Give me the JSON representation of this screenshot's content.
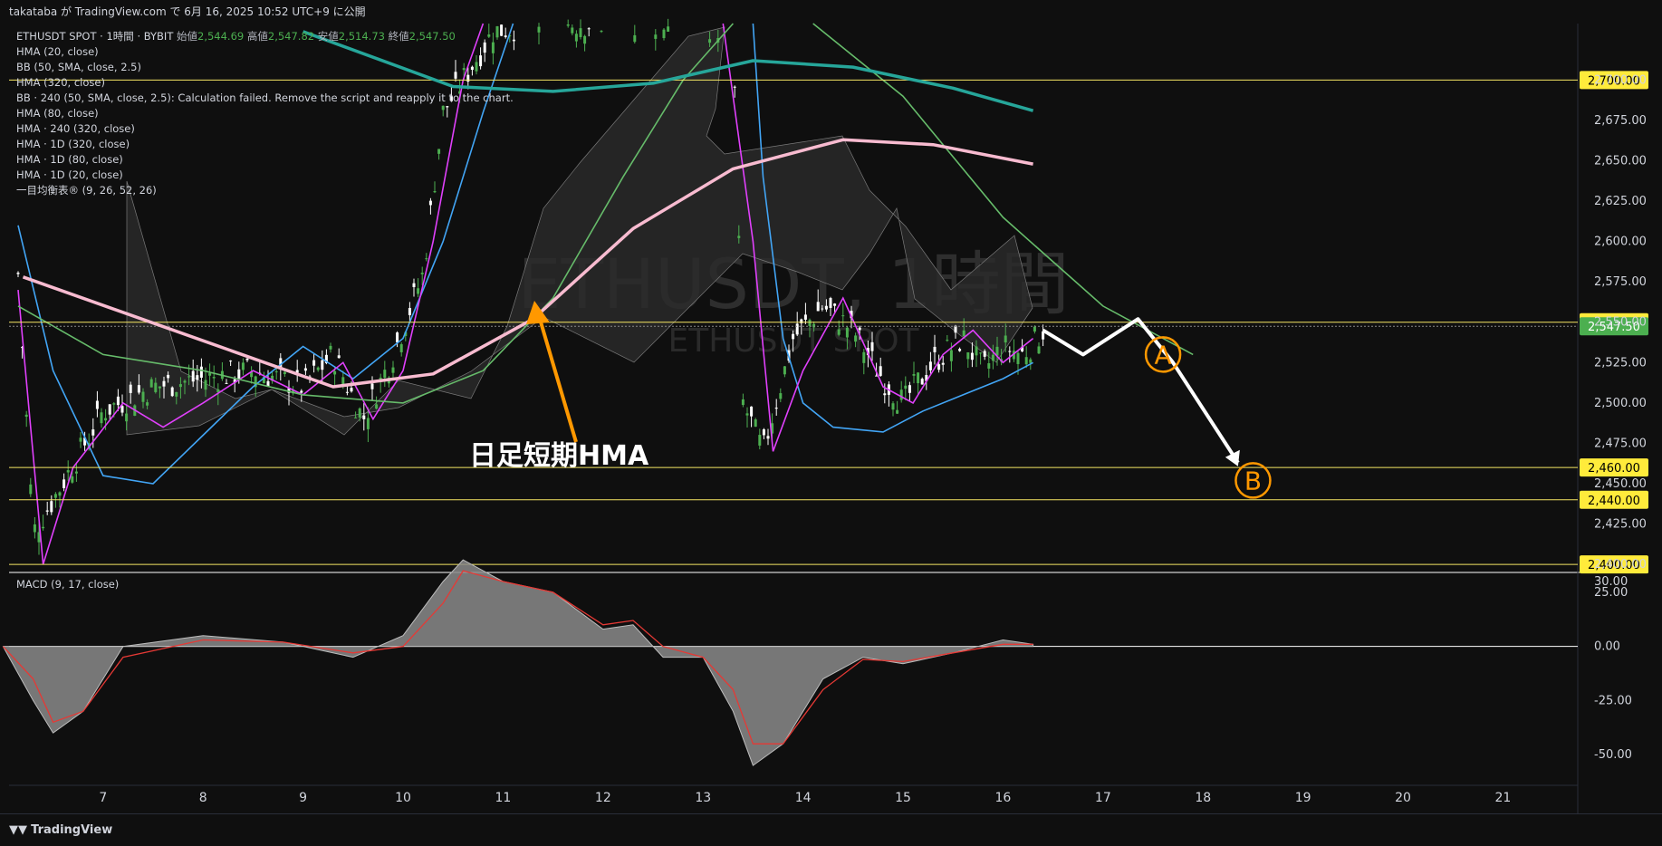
{
  "header": {
    "publish_line": "takataba が TradingView.com で 6月 16, 2025 10:52 UTC+9 に公開"
  },
  "legend": {
    "symbol": "ETHUSDT SPOT · 1時間 · BYBIT",
    "open_label": "始値",
    "open": "2,544.69",
    "high_label": "高値",
    "high": "2,547.82",
    "low_label": "安値",
    "low": "2,514.73",
    "close_label": "終値",
    "close": "2,547.50",
    "indicators": [
      "HMA (20, close)",
      "BB (50, SMA, close, 2.5)",
      "HMA (320, close)",
      "BB · 240 (50, SMA, close, 2.5): Calculation failed. Remove the script and reapply it to the chart.",
      "HMA (80, close)",
      "HMA · 240 (320, close)",
      "HMA · 1D (320, close)",
      "HMA · 1D (80, close)",
      "HMA · 1D (20, close)",
      "一目均衡表® (9, 26, 52, 26)"
    ]
  },
  "watermark": {
    "big": "ETHUSDT, 1時間",
    "small": "ETHUSDT SPOT"
  },
  "annotation": {
    "hma_label": "日足短期HMA",
    "point_a": "A",
    "point_b": "B"
  },
  "macd_label": "MACD (9, 17, close)",
  "footer": {
    "brand": "TradingView"
  },
  "colors": {
    "background": "#0f0f0f",
    "level_line": "#f5e663",
    "price_tag": "#4caf50",
    "hma_daily_short": "#f8bbd0",
    "hma_fast": "#e040fb",
    "hma_slow": "#26a69a",
    "bb": "#42a5f5",
    "arrow": "#ff9800",
    "up_candle": "#4caf50",
    "down_candle": "#ffffff"
  },
  "chart_data": [
    {
      "type": "line",
      "title": "ETHUSDT SPOT · 1時間 · BYBIT",
      "price_axis": {
        "ylim": [
          2395,
          2735
        ],
        "ticks": [
          "2,700.00",
          "2,675.00",
          "2,650.00",
          "2,625.00",
          "2,600.00",
          "2,575.00",
          "2,550.00",
          "2,525.00",
          "2,500.00",
          "2,475.00",
          "2,450.00",
          "2,425.00",
          "2,400.00"
        ]
      },
      "x_ticks": [
        "7",
        "8",
        "9",
        "10",
        "11",
        "12",
        "13",
        "14",
        "15",
        "16",
        "17",
        "18",
        "19",
        "20",
        "21"
      ],
      "levels": [
        {
          "label": "2,700.00",
          "value": 2700,
          "style": "highlight"
        },
        {
          "label": "2,550.00",
          "value": 2550,
          "style": "highlight"
        },
        {
          "label": "2,547.50",
          "value": 2547.5,
          "style": "last"
        },
        {
          "label": "2,460.00",
          "value": 2460,
          "style": "highlight"
        },
        {
          "label": "2,440.00",
          "value": 2440,
          "style": "highlight"
        },
        {
          "label": "2,400.00",
          "value": 2400,
          "style": "highlight"
        }
      ],
      "series": [
        {
          "name": "HMA · 1D (20, close)",
          "color": "#f8bbd0",
          "x": [
            6.2,
            9.3,
            10.3,
            11.3,
            12.3,
            13.3,
            14.4,
            15.3,
            16.3
          ],
          "y": [
            2578,
            2510,
            2518,
            2552,
            2608,
            2645,
            2663,
            2660,
            2648
          ]
        },
        {
          "name": "HMA · 1D (80, close)",
          "color": "#26a69a",
          "x": [
            9.0,
            10.5,
            11.5,
            12.5,
            13.5,
            14.5,
            15.5,
            16.3
          ],
          "y": [
            2730,
            2696,
            2693,
            2698,
            2712,
            2708,
            2695,
            2681
          ]
        },
        {
          "name": "projection",
          "color": "#ffffff",
          "x": [
            16.4,
            16.8,
            17.35,
            17.7,
            18.35
          ],
          "y": [
            2545,
            2530,
            2552,
            2525,
            2463
          ]
        }
      ],
      "annotations": [
        {
          "text": "A",
          "x": 17.6,
          "y": 2530
        },
        {
          "text": "B",
          "x": 18.5,
          "y": 2452
        }
      ]
    },
    {
      "type": "area",
      "title": "MACD (9, 17, close)",
      "ylim": [
        -60,
        30
      ],
      "ticks": [
        "30.00",
        "25.00",
        "0.00",
        "-25.00",
        "-50.00"
      ],
      "x": [
        6.0,
        6.3,
        6.5,
        6.8,
        7.2,
        8.0,
        8.8,
        9.5,
        10.0,
        10.4,
        10.6,
        11.0,
        11.5,
        12.0,
        12.3,
        12.6,
        13.0,
        13.3,
        13.5,
        13.8,
        14.2,
        14.6,
        15.0,
        15.5,
        16.0,
        16.3
      ],
      "values": [
        0,
        -25,
        -40,
        -30,
        0,
        5,
        2,
        -5,
        5,
        30,
        40,
        30,
        25,
        8,
        10,
        -5,
        -5,
        -30,
        -55,
        -45,
        -15,
        -5,
        -8,
        -3,
        3,
        1
      ],
      "signal": [
        0,
        -15,
        -35,
        -30,
        -5,
        3,
        2,
        -3,
        0,
        20,
        35,
        30,
        25,
        10,
        12,
        0,
        -5,
        -20,
        -45,
        -45,
        -20,
        -6,
        -7,
        -3,
        1,
        1
      ]
    }
  ]
}
